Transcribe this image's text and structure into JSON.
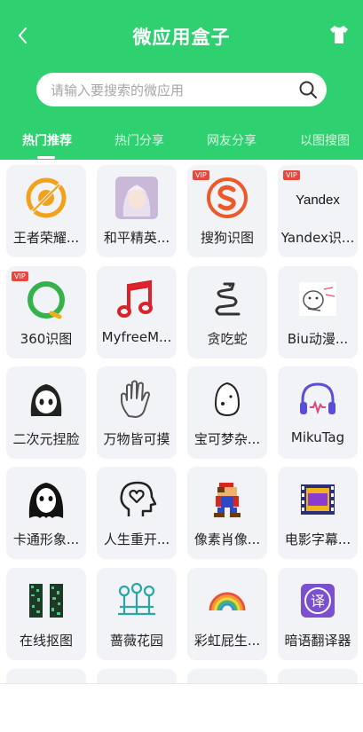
{
  "header": {
    "title": "微应用盒子",
    "color": "#2fd06f"
  },
  "search": {
    "placeholder": "请输入要搜索的微应用"
  },
  "tabs": [
    {
      "label": "热门推荐",
      "active": true
    },
    {
      "label": "热门分享",
      "active": false
    },
    {
      "label": "网友分享",
      "active": false
    },
    {
      "label": "以图搜图",
      "active": false
    }
  ],
  "vip_label": "VIP",
  "apps": [
    {
      "label": "王者荣耀...",
      "icon": "honor-of-kings-icon",
      "vip": false
    },
    {
      "label": "和平精英...",
      "icon": "peacekeeper-elite-avatar-icon",
      "vip": false
    },
    {
      "label": "搜狗识图",
      "icon": "sogou-icon",
      "vip": true
    },
    {
      "label": "Yandex识...",
      "icon": "yandex-icon",
      "vip": true
    },
    {
      "label": "360识图",
      "icon": "360-search-icon",
      "vip": true
    },
    {
      "label": "MyfreeM...",
      "icon": "music-note-icon",
      "vip": false
    },
    {
      "label": "贪吃蛇",
      "icon": "snake-icon",
      "vip": false
    },
    {
      "label": "Biu动漫...",
      "icon": "anime-doodle-icon",
      "vip": false
    },
    {
      "label": "二次元捏脸",
      "icon": "anime-face-icon",
      "vip": false
    },
    {
      "label": "万物皆可摸",
      "icon": "hand-icon",
      "vip": false
    },
    {
      "label": "宝可梦杂...",
      "icon": "egg-icon",
      "vip": false
    },
    {
      "label": "MikuTag",
      "icon": "headphones-icon",
      "vip": false
    },
    {
      "label": "卡通形象...",
      "icon": "ghost-mask-icon",
      "vip": false
    },
    {
      "label": "人生重开...",
      "icon": "head-heart-icon",
      "vip": false
    },
    {
      "label": "像素肖像...",
      "icon": "pixel-mario-icon",
      "vip": false
    },
    {
      "label": "电影字幕...",
      "icon": "film-strip-icon",
      "vip": false
    },
    {
      "label": "在线抠图",
      "icon": "qr-grid-icon",
      "vip": false
    },
    {
      "label": "蔷薇花园",
      "icon": "flower-garden-icon",
      "vip": false
    },
    {
      "label": "彩虹屁生...",
      "icon": "rainbow-icon",
      "vip": false
    },
    {
      "label": "暗语翻译器",
      "icon": "translate-icon",
      "vip": false
    }
  ]
}
